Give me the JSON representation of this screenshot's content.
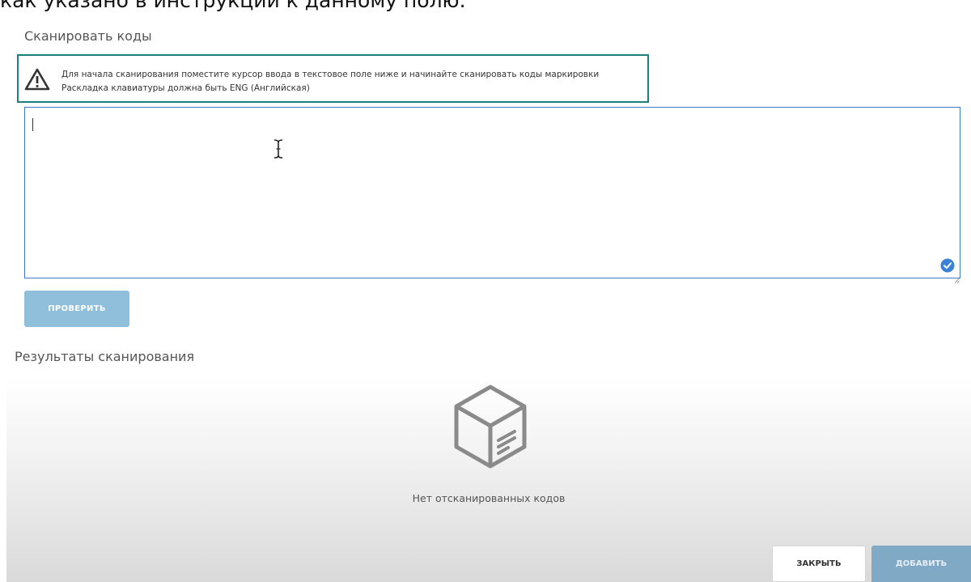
{
  "top_caption": "как указано в инструкции к данному полю.",
  "scan_section": {
    "title": "Сканировать коды",
    "alert": {
      "icon": "warning-icon",
      "line1": "Для начала сканирования поместите курсор ввода в текстовое поле ниже и начинайте сканировать коды маркировки",
      "line2": "Раскладка клавиатуры должна быть ENG (Английская)",
      "border_color": "#1f7f7a"
    },
    "textarea_value": "",
    "verify_button": "ПРОВЕРИТЬ"
  },
  "results_section": {
    "title": "Результаты сканирования",
    "empty_icon": "empty-box-icon",
    "empty_text": "Нет отсканированных кодов"
  },
  "footer": {
    "close_button": "ЗАКРЫТЬ",
    "add_button": "ДОБАВИТЬ"
  },
  "colors": {
    "accent": "#3f78c2",
    "verify_button_bg": "#8fbfdb",
    "add_button_bg": "#7fa9c4"
  }
}
